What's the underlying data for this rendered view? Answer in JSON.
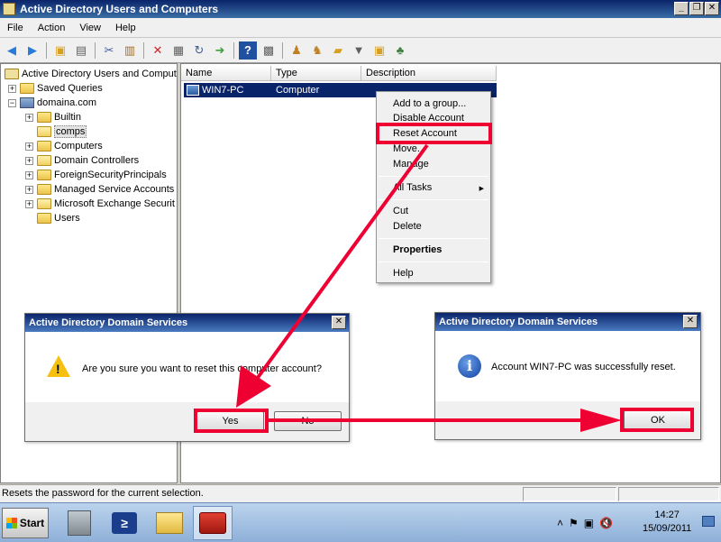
{
  "window": {
    "title": "Active Directory Users and Computers",
    "controls": {
      "minimize": "_",
      "restore": "❐",
      "close": "✕"
    }
  },
  "menu": [
    "File",
    "Action",
    "View",
    "Help"
  ],
  "tree": {
    "root": "Active Directory Users and Comput",
    "saved_queries": "Saved Queries",
    "domain": "domaina.com",
    "children": [
      "Builtin",
      "comps",
      "Computers",
      "Domain Controllers",
      "ForeignSecurityPrincipals",
      "Managed Service Accounts",
      "Microsoft Exchange Securit",
      "Users"
    ],
    "selected": "comps"
  },
  "list": {
    "columns": [
      "Name",
      "Type",
      "Description"
    ],
    "rows": [
      {
        "name": "WIN7-PC",
        "type": "Computer",
        "description": ""
      }
    ]
  },
  "context_menu": {
    "items": [
      "Add to a group...",
      "Disable Account",
      "Reset Account",
      "Move...",
      "Manage",
      "All Tasks",
      "Cut",
      "Delete",
      "Properties",
      "Help"
    ]
  },
  "status": {
    "text": "Resets the password for the current selection."
  },
  "dialog_confirm": {
    "title": "Active Directory Domain Services",
    "message": "Are you sure you want to reset this computer account?",
    "yes": "Yes",
    "no": "No"
  },
  "dialog_success": {
    "title": "Active Directory Domain Services",
    "message": "Account WIN7-PC was successfully reset.",
    "ok": "OK"
  },
  "taskbar": {
    "start": "Start",
    "time": "14:27",
    "date": "15/09/2011"
  },
  "colors": {
    "annotation": "#ee0033",
    "selection": "#0a246a",
    "titlebar": "#0a246a"
  }
}
